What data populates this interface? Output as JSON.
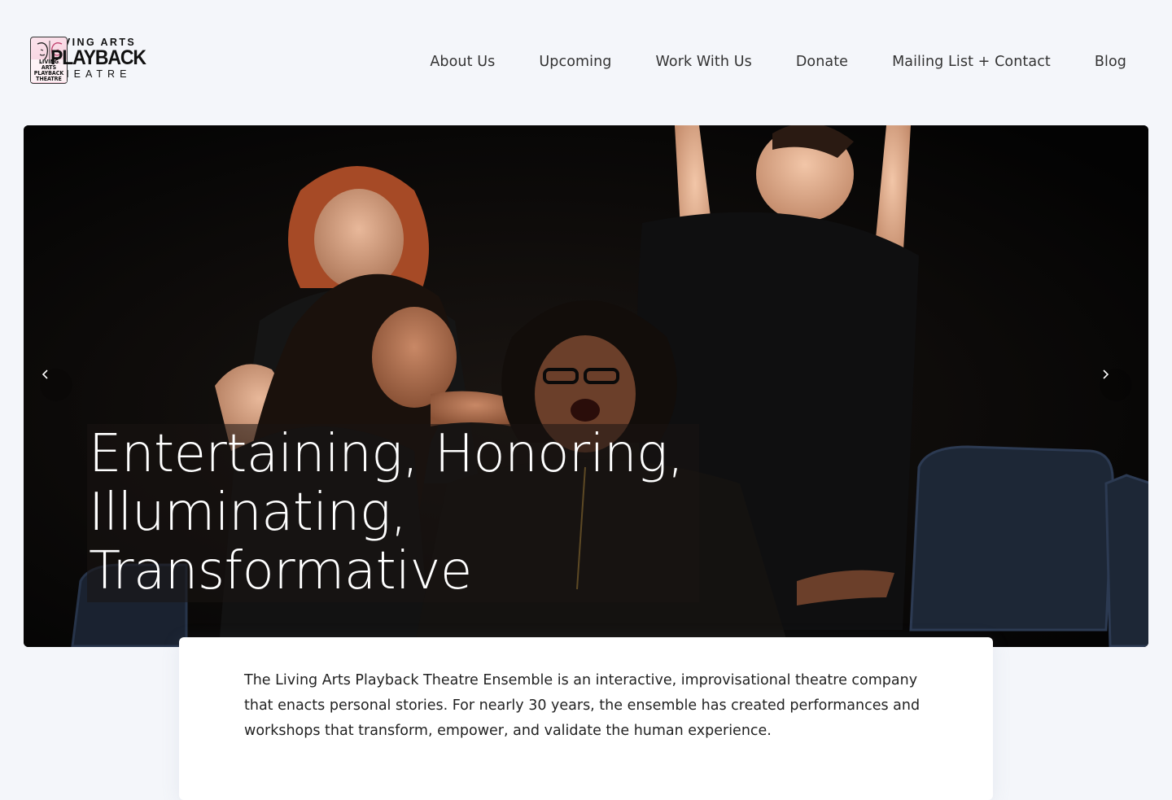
{
  "logo": {
    "line1": "LIVING  ARTS",
    "line2": "PLAYBACK",
    "line3": "THEATRE",
    "mini": "LIVING ARTS PLAYBACK THEATRE"
  },
  "nav": {
    "items": [
      {
        "label": "About Us"
      },
      {
        "label": "Upcoming"
      },
      {
        "label": "Work With Us"
      },
      {
        "label": "Donate"
      },
      {
        "label": "Mailing List + Contact"
      },
      {
        "label": "Blog"
      }
    ]
  },
  "hero": {
    "title_line1": "Entertaining, Honoring,",
    "title_line2": "Illuminating,",
    "title_line3": "Transformative",
    "prev_icon": "chevron-left-icon",
    "next_icon": "chevron-right-icon"
  },
  "intro": {
    "text": "The Living Arts Playback Theatre Ensemble is an interactive, improvisational theatre company that enacts personal stories. For nearly 30 years, the ensemble has created performances and workshops that transform, empower, and validate the human experience."
  }
}
